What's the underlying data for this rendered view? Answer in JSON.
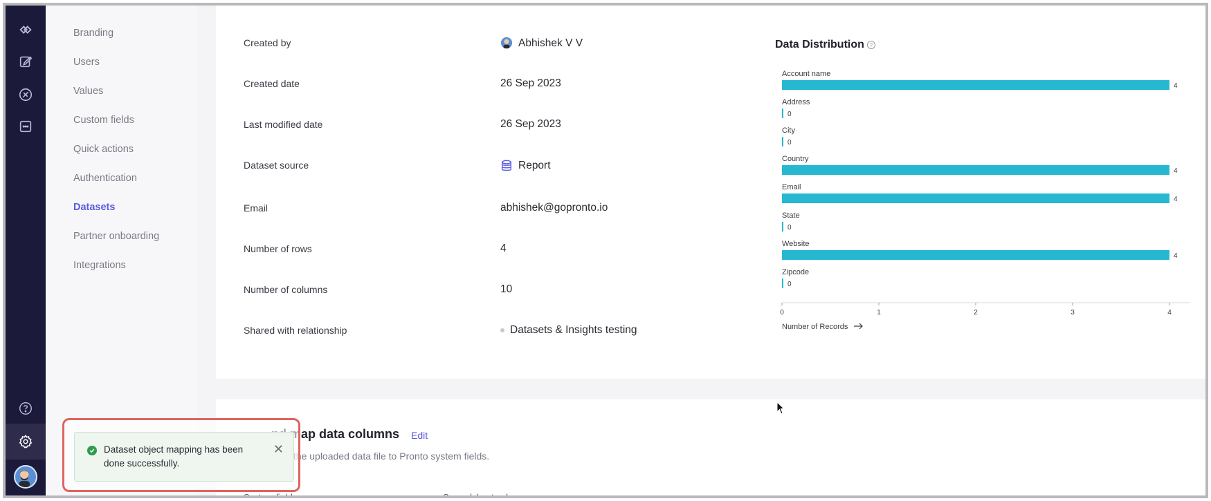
{
  "nav": {
    "items": [
      "Branding",
      "Users",
      "Values",
      "Custom fields",
      "Quick actions",
      "Authentication",
      "Datasets",
      "Partner onboarding",
      "Integrations"
    ],
    "active": "Datasets"
  },
  "details": {
    "created_by_label": "Created by",
    "created_by_value": "Abhishek V V",
    "created_date_label": "Created date",
    "created_date_value": "26 Sep 2023",
    "last_modified_label": "Last modified date",
    "last_modified_value": "26 Sep 2023",
    "source_label": "Dataset source",
    "source_value": "Report",
    "email_label": "Email",
    "email_value": "abhishek@gopronto.io",
    "rows_label": "Number of rows",
    "rows_value": "4",
    "columns_label": "Number of columns",
    "columns_value": "10",
    "shared_label": "Shared with relationship",
    "shared_value": "Datasets & Insights testing"
  },
  "chart_data": {
    "type": "bar",
    "title": "Data Distribution",
    "categories": [
      "Account name",
      "Address",
      "City",
      "Country",
      "Email",
      "State",
      "Website",
      "Zipcode"
    ],
    "values": [
      4,
      0,
      0,
      4,
      4,
      0,
      4,
      0
    ],
    "xlabel": "Number of Records",
    "xlim": [
      0,
      4
    ],
    "xticks": [
      "0",
      "1",
      "2",
      "3",
      "4"
    ],
    "bar_color": "#26b8d1",
    "orientation": "horizontal"
  },
  "mapping": {
    "heading": "nd map data columns",
    "edit_label": "Edit",
    "subtitle": "from the uploaded data file to Pronto system fields.",
    "col_system": "System fields",
    "col_spreadsheet": "Spreadsheet columns"
  },
  "toast": {
    "message": "Dataset object mapping has been done successfully."
  },
  "colors": {
    "accent": "#5a5ae0",
    "rail": "#1c1a3a",
    "success": "#2e9b4d",
    "highlight": "#e0635f"
  }
}
